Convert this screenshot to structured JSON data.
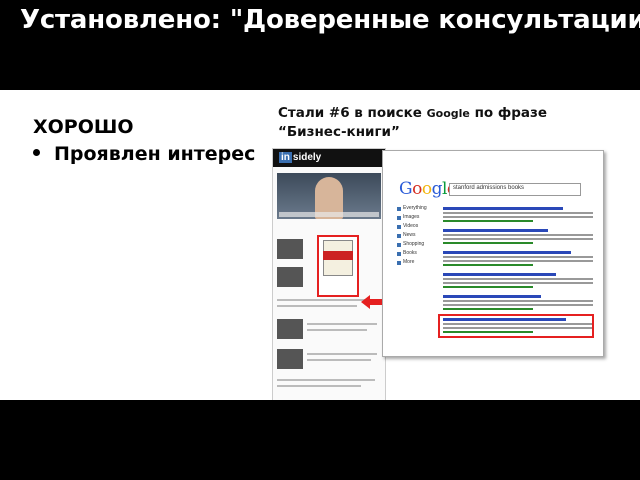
{
  "title": "Установлено: \"Доверенные консультации\"",
  "good_label": "ХОРОШО",
  "bullet": "Проявлен интерес",
  "caption": {
    "prefix": "Стали #6 в поиске ",
    "brand": "Google",
    "suffix": " по фразе “Бизнес-книги”"
  },
  "blog": {
    "logo_in": "in",
    "logo_rest": "sidely"
  },
  "google": {
    "logo": "Google",
    "query": "stanford admissions books",
    "sidebar": [
      "Everything",
      "Images",
      "Videos",
      "News",
      "Shopping",
      "Books",
      "More"
    ]
  },
  "colors": {
    "highlight": "#e52020",
    "accent": "#3a6fb0"
  }
}
